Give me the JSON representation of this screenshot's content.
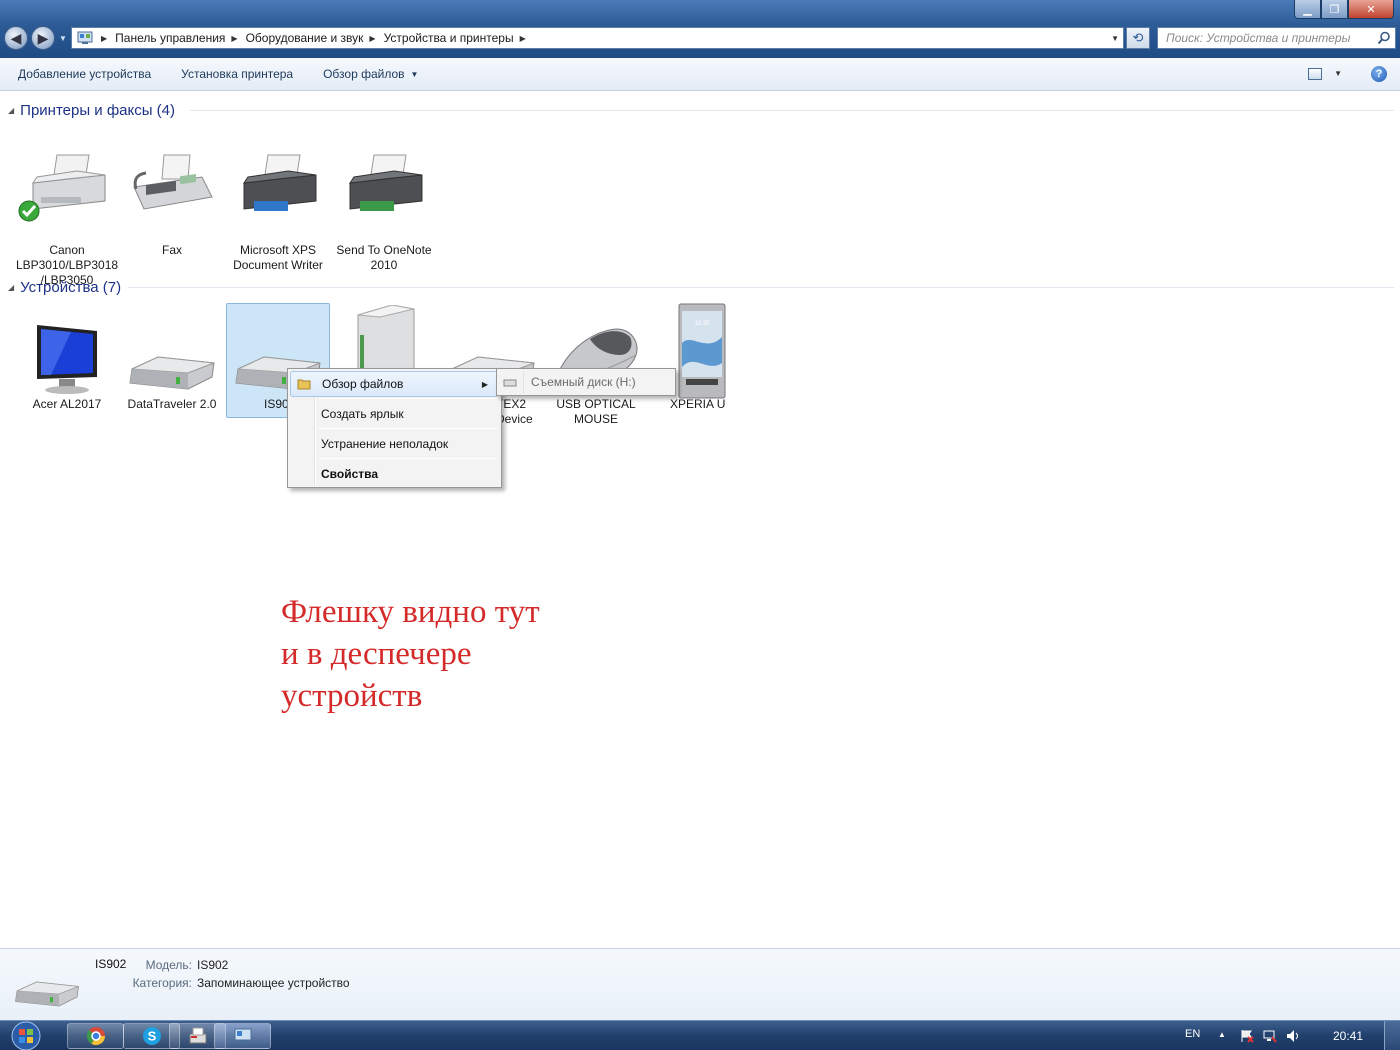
{
  "window": {
    "controls": {
      "minimize": "▁",
      "maximize": "❐",
      "close": "✕"
    }
  },
  "address": {
    "crumbs": [
      "Панель управления",
      "Оборудование и звук",
      "Устройства и принтеры"
    ],
    "search_placeholder": "Поиск: Устройства и принтеры"
  },
  "toolbar": {
    "add_device": "Добавление устройства",
    "add_printer": "Установка принтера",
    "browse_files": "Обзор файлов"
  },
  "groups": {
    "printers": {
      "label": "Принтеры и факсы (4)"
    },
    "devices": {
      "label": "Устройства (7)"
    }
  },
  "printers": [
    {
      "name": "Canon LBP3010/LBP3018 /LBP3050",
      "icon": "printer-default-icon",
      "default": true
    },
    {
      "name": "Fax",
      "icon": "fax-icon"
    },
    {
      "name": "Microsoft XPS Document Writer",
      "icon": "printer-icon"
    },
    {
      "name": "Send To OneNote 2010",
      "icon": "printer-icon"
    }
  ],
  "devices": [
    {
      "name": "Acer AL2017",
      "icon": "monitor-icon"
    },
    {
      "name": "DataTraveler 2.0",
      "icon": "drive-icon"
    },
    {
      "name": "IS90",
      "icon": "drive-icon",
      "selected": true
    },
    {
      "name": "",
      "icon": "tower-icon"
    },
    {
      "name": "TEX2 Device",
      "icon": "drive-icon"
    },
    {
      "name": "USB OPTICAL MOUSE",
      "icon": "mouse-icon"
    },
    {
      "name": "XPERIA U",
      "icon": "phone-icon"
    }
  ],
  "context_menu": {
    "items": [
      "Обзор файлов",
      "Создать ярлык",
      "Устранение неполадок",
      "Свойства"
    ],
    "submenu_item": "Съемный диск (H:)"
  },
  "annotation": {
    "lines": [
      "Флешку видно тут",
      "и в деспечере",
      "устройств"
    ],
    "color": "#d42a2a"
  },
  "details": {
    "title": "IS902",
    "model_label": "Модель:",
    "model_value": "IS902",
    "category_label": "Категория:",
    "category_value": "Запоминающее устройство"
  },
  "taskbar": {
    "lang": "EN",
    "clock": "20:41",
    "apps": [
      "chrome-icon",
      "skype-icon",
      "fax-app-icon",
      "devices-app-icon"
    ]
  },
  "colors": {
    "title_blue": "#2b5a95",
    "group_header": "#1e3287",
    "selection": "#cde6f7"
  }
}
